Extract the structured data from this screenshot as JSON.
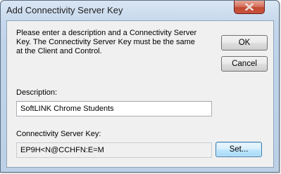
{
  "window": {
    "title": "Add Connectivity Server Key"
  },
  "dialog": {
    "instructions": "Please enter a description and a Connectivity Server Key. The Connectivity Server Key must be the same at the Client and Control.",
    "description_label": "Description:",
    "description_value": "SoftLINK Chrome Students",
    "key_label": "Connectivity Server Key:",
    "key_value": "EP9H<N@CCHFN:E=M"
  },
  "buttons": {
    "ok": "OK",
    "cancel": "Cancel",
    "set": "Set..."
  },
  "icons": {
    "close": "close-icon"
  },
  "colors": {
    "close_button": "#c8553d",
    "window_frame": "#c6d8ec",
    "client_background": "#f0f0f0"
  }
}
